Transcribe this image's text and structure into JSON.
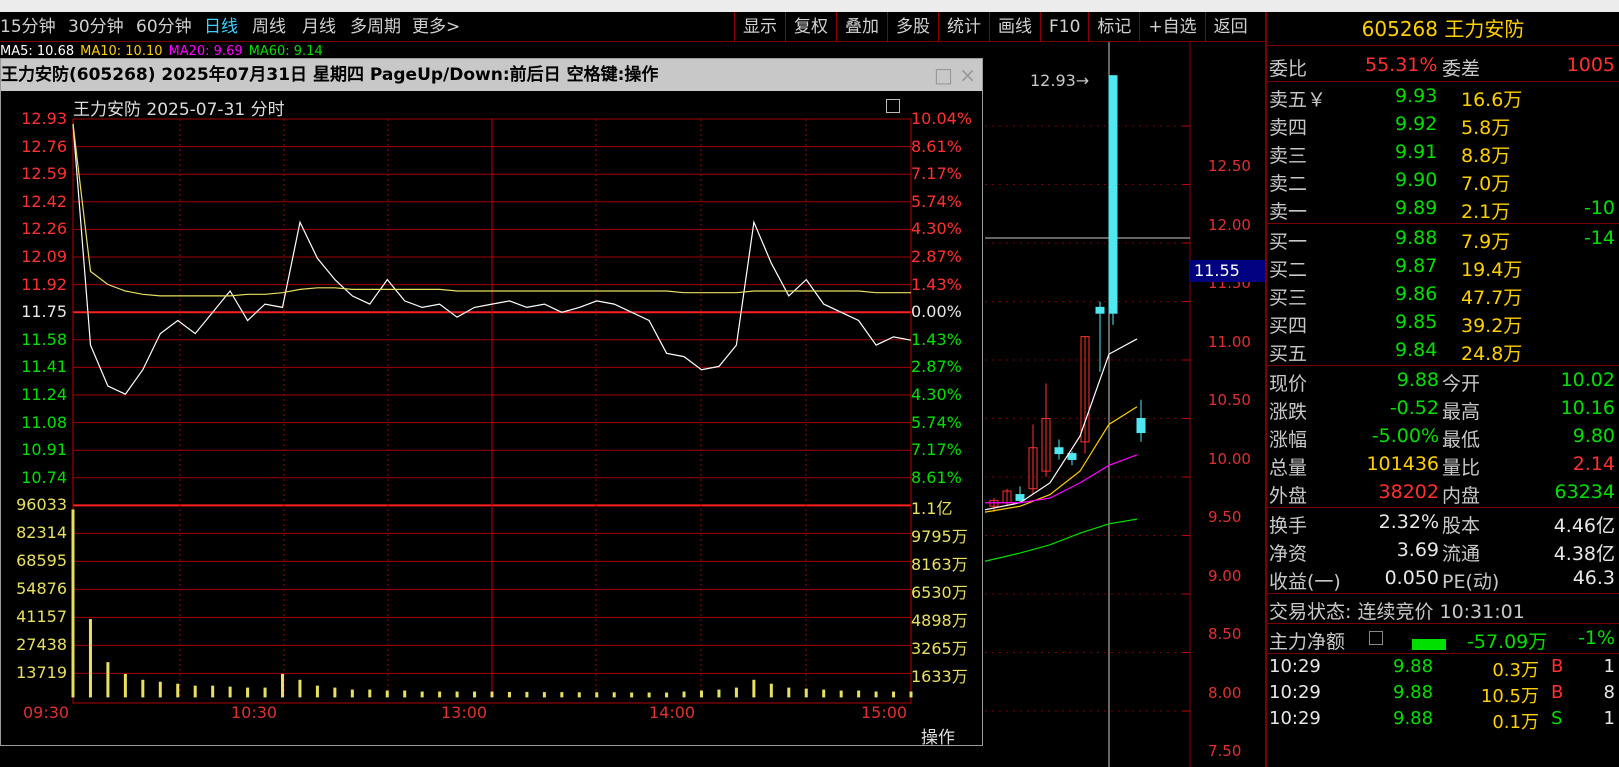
{
  "toolbar": {
    "periods": [
      {
        "label": "15分钟"
      },
      {
        "label": "30分钟"
      },
      {
        "label": "60分钟"
      },
      {
        "label": "日线",
        "active": true
      },
      {
        "label": "周线"
      },
      {
        "label": "月线"
      },
      {
        "label": "多周期"
      },
      {
        "label": "更多>"
      }
    ],
    "buttons": [
      "显示",
      "复权",
      "叠加",
      "多股",
      "统计",
      "画线",
      "F10",
      "标记",
      "+自选",
      "返回"
    ]
  },
  "candle_chart": {
    "ma_legend": [
      {
        "label": "MA5: 10.68",
        "color": "#ffffff"
      },
      {
        "label": "MA10: 10.10",
        "color": "#ffd000"
      },
      {
        "label": "MA20: 9.69",
        "color": "#ff00ff"
      },
      {
        "label": "MA60: 9.14",
        "color": "#00e000"
      }
    ],
    "high_marker": "12.93",
    "cursor_price": "11.55",
    "y_ticks": [
      "12.50",
      "12.00",
      "11.50",
      "11.00",
      "10.50",
      "10.00",
      "9.50",
      "9.00",
      "8.50",
      "8.00",
      "7.50"
    ]
  },
  "popup": {
    "title": "王力安防(605268) 2025年07月31日 星期四 PageUp/Down:前后日 空格键:操作",
    "close_glyph": "×",
    "restore_glyph": "□",
    "subtitle": "王力安防  2025-07-31 分时",
    "op_label": "操作",
    "price_ticks": [
      "12.93",
      "12.76",
      "12.59",
      "12.42",
      "12.26",
      "12.09",
      "11.92",
      "11.75",
      "11.58",
      "11.41",
      "11.24",
      "11.08",
      "10.91",
      "10.74"
    ],
    "pct_ticks": [
      "10.04%",
      "8.61%",
      "7.17%",
      "5.74%",
      "4.30%",
      "2.87%",
      "1.43%",
      "0.00%",
      "1.43%",
      "2.87%",
      "4.30%",
      "5.74%",
      "7.17%",
      "8.61%"
    ],
    "volume_ticks": [
      "96033",
      "82314",
      "68595",
      "54876",
      "41157",
      "27438",
      "13719"
    ],
    "amount_ticks": [
      "1.1亿",
      "9795万",
      "8163万",
      "6530万",
      "4898万",
      "3265万",
      "1633万"
    ],
    "time_ticks": [
      "09:30",
      "10:30",
      "13:00",
      "14:00",
      "15:00"
    ]
  },
  "chart_data": {
    "type": "line",
    "title": "王力安防  2025-07-31 分时",
    "prev_close": 11.75,
    "ylim": [
      10.74,
      12.93
    ],
    "x": [
      "09:30",
      "09:35",
      "09:40",
      "09:45",
      "09:50",
      "09:55",
      "10:00",
      "10:05",
      "10:10",
      "10:15",
      "10:20",
      "10:25",
      "10:30",
      "10:35",
      "10:40",
      "10:45",
      "10:50",
      "10:55",
      "11:00",
      "11:05",
      "11:10",
      "11:15",
      "11:20",
      "11:25",
      "13:00",
      "13:05",
      "13:10",
      "13:15",
      "13:20",
      "13:25",
      "13:30",
      "13:35",
      "13:40",
      "13:45",
      "13:50",
      "13:55",
      "14:00",
      "14:05",
      "14:10",
      "14:15",
      "14:20",
      "14:25",
      "14:30",
      "14:35",
      "14:40",
      "14:45",
      "14:50",
      "14:55",
      "15:00"
    ],
    "series": [
      {
        "name": "price",
        "color": "#ffffff",
        "values": [
          12.9,
          11.55,
          11.3,
          11.25,
          11.4,
          11.62,
          11.7,
          11.62,
          11.75,
          11.88,
          11.7,
          11.8,
          11.78,
          12.3,
          12.08,
          11.95,
          11.85,
          11.8,
          11.95,
          11.82,
          11.78,
          11.8,
          11.72,
          11.78,
          11.8,
          11.82,
          11.78,
          11.8,
          11.75,
          11.78,
          11.82,
          11.8,
          11.75,
          11.7,
          11.5,
          11.48,
          11.4,
          11.42,
          11.55,
          12.3,
          12.05,
          11.85,
          11.95,
          11.8,
          11.75,
          11.7,
          11.55,
          11.6,
          11.58
        ]
      },
      {
        "name": "avg",
        "color": "#e8e060",
        "values": [
          12.9,
          12.0,
          11.92,
          11.88,
          11.86,
          11.85,
          11.85,
          11.85,
          11.85,
          11.85,
          11.86,
          11.86,
          11.87,
          11.89,
          11.9,
          11.9,
          11.89,
          11.89,
          11.89,
          11.89,
          11.89,
          11.89,
          11.88,
          11.88,
          11.88,
          11.88,
          11.88,
          11.88,
          11.88,
          11.88,
          11.88,
          11.88,
          11.88,
          11.88,
          11.88,
          11.87,
          11.87,
          11.87,
          11.87,
          11.88,
          11.88,
          11.88,
          11.88,
          11.88,
          11.88,
          11.88,
          11.87,
          11.87,
          11.87
        ]
      }
    ],
    "volume": [
      96000,
      40000,
      18000,
      12000,
      9000,
      8000,
      7000,
      6000,
      6000,
      5500,
      5000,
      5000,
      12000,
      9000,
      6000,
      5000,
      4000,
      4000,
      3500,
      3500,
      3000,
      3000,
      3000,
      3000,
      3000,
      2800,
      2800,
      2700,
      2700,
      2600,
      2600,
      2600,
      2500,
      2500,
      2500,
      3000,
      3500,
      4000,
      5000,
      9000,
      7000,
      5000,
      4500,
      4000,
      3500,
      3500,
      3000,
      3000,
      3000
    ]
  },
  "quote": {
    "code_name": "605268 王力安防",
    "weibi_label": "委比",
    "weibi": "55.31%",
    "weicha_label": "委差",
    "weicha": "1005",
    "asks": [
      {
        "label": "卖五￥",
        "price": "9.93",
        "vol": "16.6万",
        "chg": ""
      },
      {
        "label": "卖四",
        "price": "9.92",
        "vol": "5.8万",
        "chg": ""
      },
      {
        "label": "卖三",
        "price": "9.91",
        "vol": "8.8万",
        "chg": ""
      },
      {
        "label": "卖二",
        "price": "9.90",
        "vol": "7.0万",
        "chg": ""
      },
      {
        "label": "卖一",
        "price": "9.89",
        "vol": "2.1万",
        "chg": "-10"
      }
    ],
    "bids": [
      {
        "label": "买一",
        "price": "9.88",
        "vol": "7.9万",
        "chg": "-14"
      },
      {
        "label": "买二",
        "price": "9.87",
        "vol": "19.4万",
        "chg": ""
      },
      {
        "label": "买三",
        "price": "9.86",
        "vol": "47.7万",
        "chg": ""
      },
      {
        "label": "买四",
        "price": "9.85",
        "vol": "39.2万",
        "chg": ""
      },
      {
        "label": "买五",
        "price": "9.84",
        "vol": "24.8万",
        "chg": ""
      }
    ],
    "stats": [
      {
        "l1": "现价",
        "v1": "9.88",
        "c1": "green",
        "l2": "今开",
        "v2": "10.02",
        "c2": "green"
      },
      {
        "l1": "涨跌",
        "v1": "-0.52",
        "c1": "green",
        "l2": "最高",
        "v2": "10.16",
        "c2": "green"
      },
      {
        "l1": "涨幅",
        "v1": "-5.00%",
        "c1": "green",
        "l2": "最低",
        "v2": "9.80",
        "c2": "green"
      },
      {
        "l1": "总量",
        "v1": "101436",
        "c1": "yellow",
        "l2": "量比",
        "v2": "2.14",
        "c2": "red"
      },
      {
        "l1": "外盘",
        "v1": "38202",
        "c1": "red",
        "l2": "内盘",
        "v2": "63234",
        "c2": "green"
      }
    ],
    "stats2": [
      {
        "l1": "换手",
        "v1": "2.32%",
        "l2": "股本",
        "v2": "4.46亿"
      },
      {
        "l1": "净资",
        "v1": "3.69",
        "l2": "流通",
        "v2": "4.38亿"
      },
      {
        "l1": "收益(一)",
        "v1": "0.050",
        "l2": "PE(动)",
        "v2": "46.3"
      }
    ],
    "status": "交易状态: 连续竞价 10:31:01",
    "main_fund_label": "主力净额",
    "main_fund_value": "-57.09万",
    "main_fund_pct": "-1%",
    "trades": [
      {
        "time": "10:29",
        "price": "9.88",
        "vol": "0.3万",
        "side": "B",
        "n": "1"
      },
      {
        "time": "10:29",
        "price": "9.88",
        "vol": "10.5万",
        "side": "B",
        "n": "8"
      },
      {
        "time": "10:29",
        "price": "9.88",
        "vol": "0.1万",
        "side": "S",
        "n": "1"
      }
    ]
  }
}
